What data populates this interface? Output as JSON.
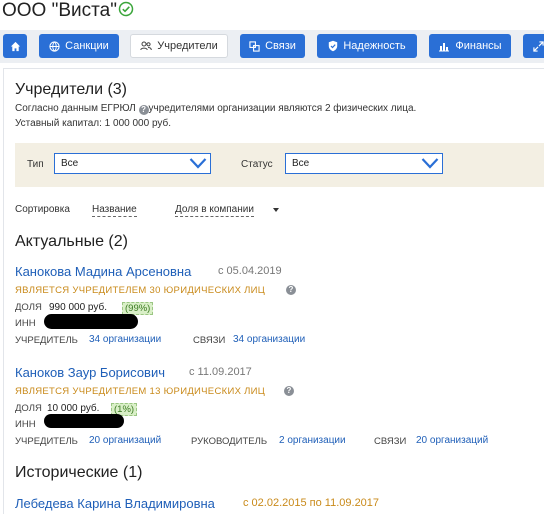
{
  "header": {
    "company_title": "ООО \"Виста\""
  },
  "nav": {
    "sanctions": "Санкции",
    "founders": "Учредители",
    "links": "Связи",
    "reliability": "Надежность",
    "finance": "Финансы"
  },
  "founders": {
    "title": "Учредители (3)",
    "desc_1": "Согласно данным ЕГРЮЛ",
    "desc_2": "учредителями организации являются 2 физических лица.",
    "capital": "Уставный капитал: 1 000 000 руб."
  },
  "filters": {
    "type_label": "Тип",
    "type_value": "Все",
    "status_label": "Статус",
    "status_value": "Все"
  },
  "sort": {
    "label": "Сортировка",
    "by_name": "Название",
    "by_share": "Доля в компании"
  },
  "sections": {
    "current": "Актуальные (2)",
    "historical": "Исторические (1)"
  },
  "people": [
    {
      "name": "Канокова Мадина Арсеновна",
      "since": "с 05.04.2019",
      "role": "ЯВЛЯЕТСЯ УЧРЕДИТЕЛЕМ 30 ЮРИДИЧЕСКИХ ЛИЦ",
      "share_label": "ДОЛЯ",
      "share_value": "990 000 руб.",
      "share_pct": "(99%)",
      "inn_label": "ИНН",
      "founder_label": "УЧРЕДИТЕЛЬ",
      "founder_link": "34 организации",
      "links_label": "СВЯЗИ",
      "links_link": "34 организации"
    },
    {
      "name": "Каноков Заур Борисович",
      "since": "с 11.09.2017",
      "role": "ЯВЛЯЕТСЯ УЧРЕДИТЕЛЕМ 13 ЮРИДИЧЕСКИХ ЛИЦ",
      "share_label": "ДОЛЯ",
      "share_value": "10 000 руб.",
      "share_pct": "(1%)",
      "inn_label": "ИНН",
      "founder_label": "УЧРЕДИТЕЛЬ",
      "founder_link": "20 организаций",
      "head_label": "РУКОВОДИТЕЛЬ",
      "head_link": "2 организации",
      "links_label": "СВЯЗИ",
      "links_link": "20 организаций"
    }
  ],
  "historical_person": {
    "name": "Лебедева Карина Владимировна",
    "period": "с 02.02.2015 по 11.09.2017"
  },
  "colors": {
    "accent": "#2a6fd6",
    "link": "#1f5fb8",
    "role": "#c98a1a",
    "filter_bg": "#f3efe3"
  }
}
